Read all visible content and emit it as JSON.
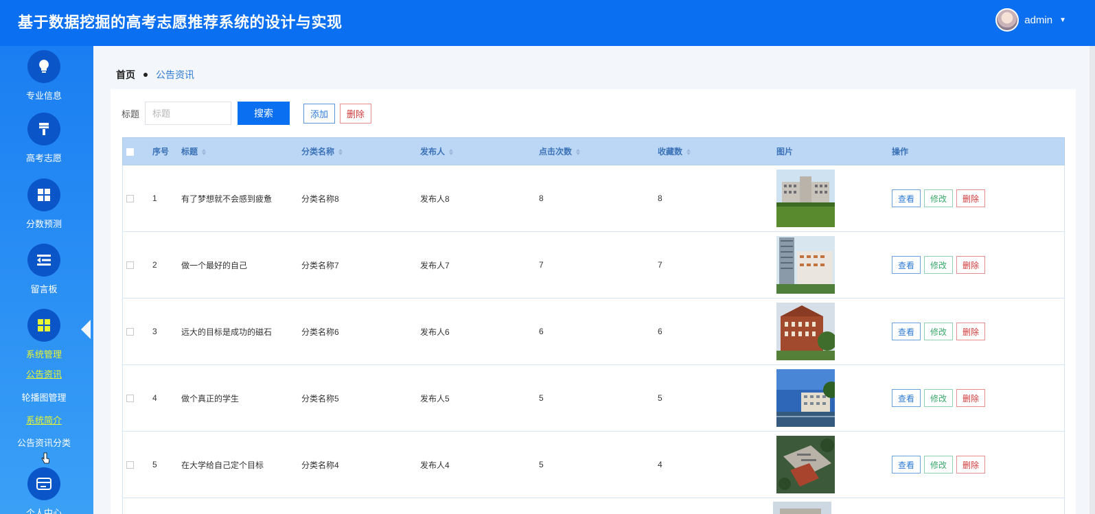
{
  "header": {
    "title": "基于数据挖掘的高考志愿推荐系统的设计与实现",
    "username": "admin"
  },
  "sidebar": {
    "items": [
      {
        "label": "专业信息",
        "icon": "lightbulb-icon"
      },
      {
        "label": "高考志愿",
        "icon": "brush-icon"
      },
      {
        "label": "分数预测",
        "icon": "grid-icon"
      },
      {
        "label": "留言板",
        "icon": "menu-fold-icon"
      },
      {
        "label": "系统管理",
        "icon": "grid-icon"
      },
      {
        "label": "个人中心",
        "icon": "card-icon"
      }
    ],
    "subitems": [
      {
        "label": "公告资讯"
      },
      {
        "label": "轮播图管理"
      },
      {
        "label": "系统简介"
      },
      {
        "label": "公告资讯分类"
      }
    ],
    "active_color": "#e8f531"
  },
  "breadcrumb": {
    "home": "首页",
    "current": "公告资讯"
  },
  "search": {
    "label": "标题",
    "placeholder": "标题",
    "search_button": "搜索",
    "add_button": "添加",
    "delete_button": "删除"
  },
  "table": {
    "headers": [
      "序号",
      "标题",
      "分类名称",
      "发布人",
      "点击次数",
      "收藏数",
      "图片",
      "操作"
    ],
    "rows": [
      {
        "index": "1",
        "title": "有了梦想就不会感到疲惫",
        "category": "分类名称8",
        "publisher": "发布人8",
        "clicks": "8",
        "favorites": "8"
      },
      {
        "index": "2",
        "title": "做一个最好的自己",
        "category": "分类名称7",
        "publisher": "发布人7",
        "clicks": "7",
        "favorites": "7"
      },
      {
        "index": "3",
        "title": "远大的目标是成功的磁石",
        "category": "分类名称6",
        "publisher": "发布人6",
        "clicks": "6",
        "favorites": "6"
      },
      {
        "index": "4",
        "title": "做个真正的学生",
        "category": "分类名称5",
        "publisher": "发布人5",
        "clicks": "5",
        "favorites": "5"
      },
      {
        "index": "5",
        "title": "在大学给自己定个目标",
        "category": "分类名称4",
        "publisher": "发布人4",
        "clicks": "5",
        "favorites": "4"
      }
    ],
    "actions": {
      "view": "查看",
      "edit": "修改",
      "delete": "删除"
    }
  },
  "colors": {
    "header_bg": "#0a6ff0",
    "table_header_bg": "#bcd6f5",
    "primary": "#0a6ff0",
    "danger": "#d03a3a",
    "success": "#3aa86c"
  }
}
